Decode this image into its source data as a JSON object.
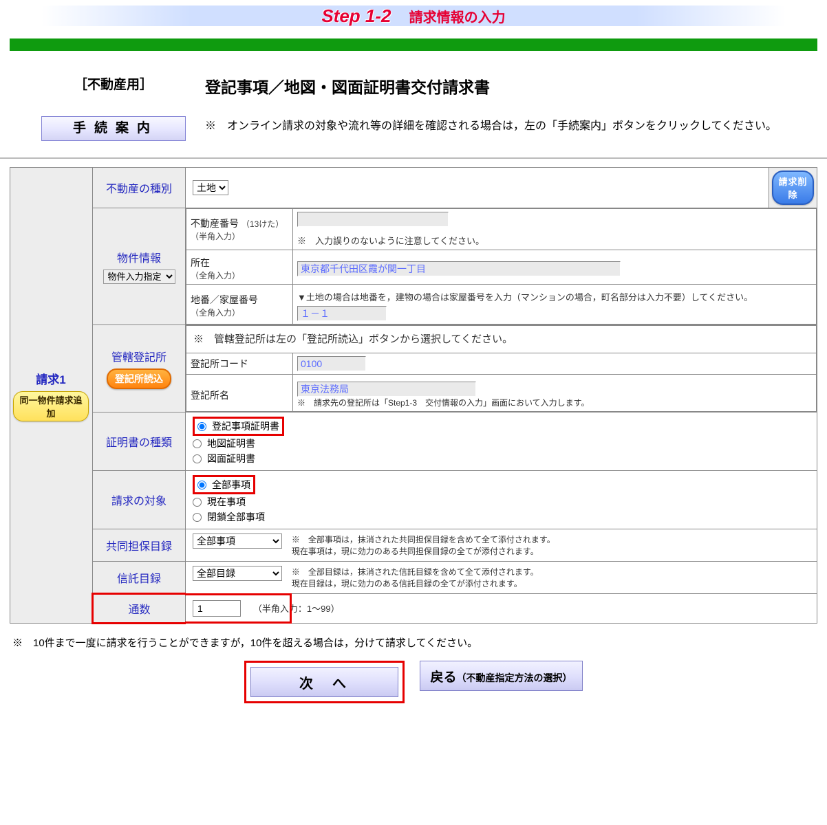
{
  "step": {
    "title": "Step 1-2",
    "subtitle": "請求情報の入力"
  },
  "header": {
    "bracket": "［不動産用］",
    "guide_btn": "手続案内",
    "form_title": "登記事項／地図・図面証明書交付請求書",
    "note": "※　オンライン請求の対象や流れ等の詳細を確認される場合は，左の「手続案内」ボタンをクリックしてください。"
  },
  "request": {
    "label": "請求1",
    "same_prop_btn": "同一物件請求追加",
    "delete_btn": "請求削除"
  },
  "rows": {
    "kind": {
      "label": "不動産の種別",
      "options": [
        "土地"
      ],
      "value": "土地"
    },
    "property": {
      "label": "物件情報",
      "mode_options": [
        "物件入力指定"
      ],
      "number": {
        "label": "不動産番号",
        "hint": "（13けた）",
        "sub": "（半角入力）",
        "value": "",
        "note": "※　入力誤りのないように注意してください。"
      },
      "location": {
        "label": "所在",
        "sub": "（全角入力）",
        "value": "東京都千代田区霞が関一丁目"
      },
      "lot": {
        "label": "地番／家屋番号",
        "sub": "（全角入力）",
        "note": "▼土地の場合は地番を，建物の場合は家屋番号を入力（マンションの場合，町名部分は入力不要）してください。",
        "value": "１－１"
      }
    },
    "jurisdiction": {
      "label": "管轄登記所",
      "load_btn": "登記所読込",
      "note_top": "※　管轄登記所は左の「登記所読込」ボタンから選択してください。",
      "code_label": "登記所コード",
      "code_value": "0100",
      "name_label": "登記所名",
      "name_value": "東京法務局",
      "note_bottom": "※　請求先の登記所は「Step1-3　交付情報の入力」画面において入力します。"
    },
    "cert_type": {
      "label": "証明書の種類",
      "opt1": "登記事項証明書",
      "opt2": "地図証明書",
      "opt3": "図面証明書"
    },
    "target": {
      "label": "請求の対象",
      "opt1": "全部事項",
      "opt2": "現在事項",
      "opt3": "閉鎖全部事項"
    },
    "joint": {
      "label": "共同担保目録",
      "options": [
        "全部事項"
      ],
      "note": "※　全部事項は，抹消された共同担保目録を含めて全て添付されます。\n現在事項は，現に効力のある共同担保目録の全てが添付されます。"
    },
    "trust": {
      "label": "信託目録",
      "options": [
        "全部目録"
      ],
      "note": "※　全部目録は，抹消された信託目録を含めて全て添付されます。\n現在目録は，現に効力のある信託目録の全てが添付されます。"
    },
    "copies": {
      "label": "通数",
      "value": "1",
      "hint": "（半角入力：1～99）"
    }
  },
  "footer_note": "※　10件まで一度に請求を行うことができますが，10件を超える場合は，分けて請求してください。",
  "buttons": {
    "next": "次へ",
    "back": "戻る",
    "back_sub": "（不動産指定方法の選択）"
  }
}
